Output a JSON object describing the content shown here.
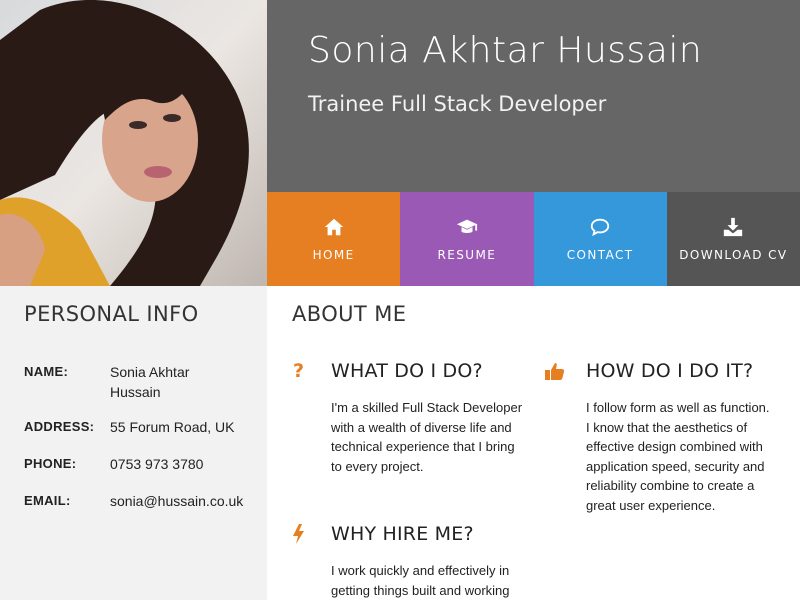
{
  "header": {
    "name": "Sonia Akhtar Hussain",
    "subtitle": "Trainee Full Stack Developer"
  },
  "nav": [
    {
      "label": "HOME",
      "icon": "home-icon",
      "color": "#e67e22"
    },
    {
      "label": "RESUME",
      "icon": "graduation-cap-icon",
      "color": "#9b59b6"
    },
    {
      "label": "CONTACT",
      "icon": "speech-bubble-icon",
      "color": "#3498db"
    },
    {
      "label": "DOWNLOAD CV",
      "icon": "download-icon",
      "color": "#555555"
    }
  ],
  "personal_info": {
    "title": "PERSONAL INFO",
    "rows": [
      {
        "key": "NAME:",
        "value": "Sonia Akhtar Hussain"
      },
      {
        "key": "ADDRESS:",
        "value": "55 Forum Road, UK"
      },
      {
        "key": "PHONE:",
        "value": "0753 973 3780"
      },
      {
        "key": "EMAIL:",
        "value": "sonia@hussain.co.uk"
      }
    ]
  },
  "about": {
    "title": "ABOUT ME",
    "features": [
      {
        "icon": "question-icon",
        "title": "WHAT DO I DO?",
        "text": "I'm a skilled Full Stack Developer with a wealth of diverse life and technical experience that I bring to every project."
      },
      {
        "icon": "thumbs-up-icon",
        "title": "HOW DO I DO IT?",
        "text": "I follow form as well as function. I know that the aesthetics of effective design combined with application speed, security and reliability combine to create a great user experience."
      },
      {
        "icon": "bolt-icon",
        "title": "WHY HIRE ME?",
        "text": "I work quickly and effectively in getting things built and working"
      }
    ]
  },
  "colors": {
    "accent": "#e67e22",
    "header_bg": "#666666",
    "sidebar_bg": "#f2f2f2"
  }
}
